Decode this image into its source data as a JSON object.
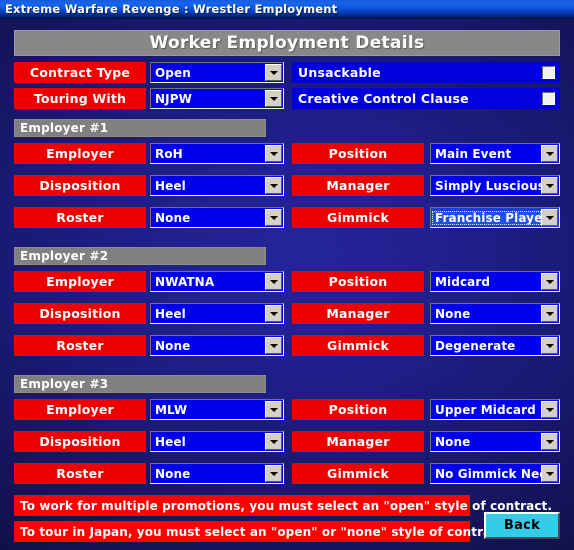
{
  "window": {
    "title": "Extreme Warfare Revenge : Wrestler Employment"
  },
  "header": {
    "title": "Worker Employment Details"
  },
  "top_controls": {
    "rows": [
      {
        "label": "Contract Type",
        "value": "Open"
      },
      {
        "label": "Touring With",
        "value": "NJPW"
      }
    ],
    "checkboxes": [
      {
        "label": "Unsackable",
        "checked": false
      },
      {
        "label": "Creative Control Clause",
        "checked": false
      }
    ]
  },
  "employers": [
    {
      "section_title": "Employer #1",
      "left": [
        {
          "label": "Employer",
          "value": "RoH",
          "focused": false
        },
        {
          "label": "Disposition",
          "value": "Heel",
          "focused": false
        },
        {
          "label": "Roster",
          "value": "None",
          "focused": false
        }
      ],
      "right": [
        {
          "label": "Position",
          "value": "Main Event",
          "focused": false
        },
        {
          "label": "Manager",
          "value": "Simply Luscious",
          "focused": false
        },
        {
          "label": "Gimmick",
          "value": "Franchise Player",
          "focused": true
        }
      ]
    },
    {
      "section_title": "Employer #2",
      "left": [
        {
          "label": "Employer",
          "value": "NWATNA",
          "focused": false
        },
        {
          "label": "Disposition",
          "value": "Heel",
          "focused": false
        },
        {
          "label": "Roster",
          "value": "None",
          "focused": false
        }
      ],
      "right": [
        {
          "label": "Position",
          "value": "Midcard",
          "focused": false
        },
        {
          "label": "Manager",
          "value": "None",
          "focused": false
        },
        {
          "label": "Gimmick",
          "value": "Degenerate",
          "focused": false
        }
      ]
    },
    {
      "section_title": "Employer #3",
      "left": [
        {
          "label": "Employer",
          "value": "MLW",
          "focused": false
        },
        {
          "label": "Disposition",
          "value": "Heel",
          "focused": false
        },
        {
          "label": "Roster",
          "value": "None",
          "focused": false
        }
      ],
      "right": [
        {
          "label": "Position",
          "value": "Upper Midcard",
          "focused": false
        },
        {
          "label": "Manager",
          "value": "None",
          "focused": false
        },
        {
          "label": "Gimmick",
          "value": "No Gimmick Needed",
          "focused": false
        }
      ]
    }
  ],
  "warnings": [
    "To work for multiple promotions, you must select an \"open\" style of contract.",
    "To tour in Japan, you must select an \"open\" or \"none\" style of contract."
  ],
  "footer": {
    "back_label": "Back"
  },
  "icons": {
    "dropdown_arrow": "chevron-down-icon"
  },
  "colors": {
    "label_red": "#ee0000",
    "warning_red": "#ff0000",
    "combo_blue": "#0000ee",
    "section_grey": "#808080",
    "back_cyan": "#33cdea",
    "background_navy": "#191970"
  }
}
